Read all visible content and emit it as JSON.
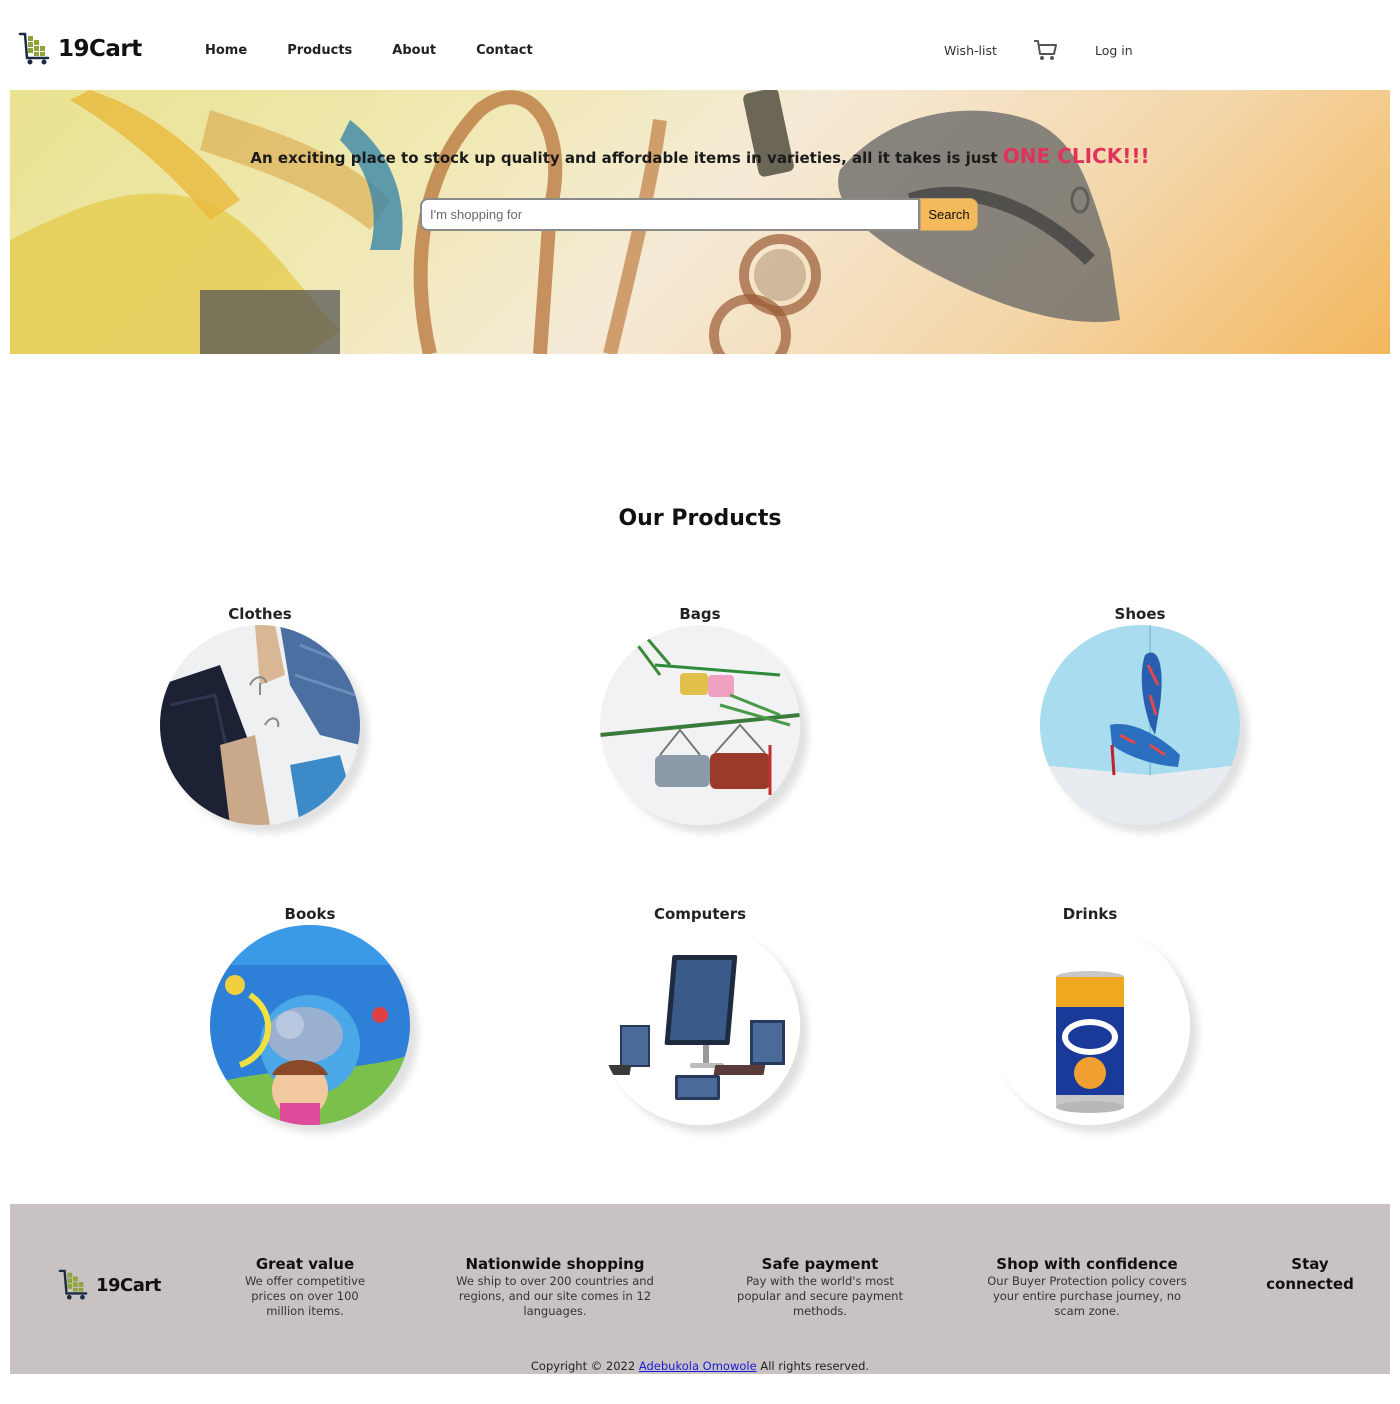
{
  "brand": {
    "name": "19Cart"
  },
  "nav": {
    "items": [
      {
        "label": "Home"
      },
      {
        "label": "Products"
      },
      {
        "label": "About"
      },
      {
        "label": "Contact"
      }
    ],
    "wishlist": "Wish-list",
    "cart_icon": "cart-icon",
    "login": "Log in"
  },
  "hero": {
    "tagline": "An exciting place to stock up quality and affordable items in varieties, all it takes is just",
    "accent": "ONE CLICK!!!",
    "accent_color": "#e0335c",
    "search_placeholder": "I'm shopping for",
    "search_button": "Search"
  },
  "products": {
    "title": "Our Products",
    "items": [
      {
        "label": "Clothes"
      },
      {
        "label": "Bags"
      },
      {
        "label": "Shoes"
      },
      {
        "label": "Books"
      },
      {
        "label": "Computers"
      },
      {
        "label": "Drinks"
      }
    ]
  },
  "footer": {
    "brand": "19Cart",
    "columns": [
      {
        "title": "Great value",
        "text": "We offer competitive prices on over 100 million items."
      },
      {
        "title": "Nationwide shopping",
        "text": "We ship to over 200 countries and regions, and our site comes in 12 languages."
      },
      {
        "title": "Safe payment",
        "text": "Pay with the world's most popular and secure payment methods."
      },
      {
        "title": "Shop with confidence",
        "text": "Our Buyer Protection policy covers your entire purchase journey, no scam zone."
      },
      {
        "title": "Stay connected",
        "text": ""
      }
    ],
    "copyright_prefix": "Copyright © 2022",
    "author": "Adebukola Omowole",
    "copyright_suffix": "All rights reserved."
  },
  "colors": {
    "accent": "#e0335c",
    "search_button": "#f4b95a",
    "footer_bg": "#c8c3c2"
  }
}
